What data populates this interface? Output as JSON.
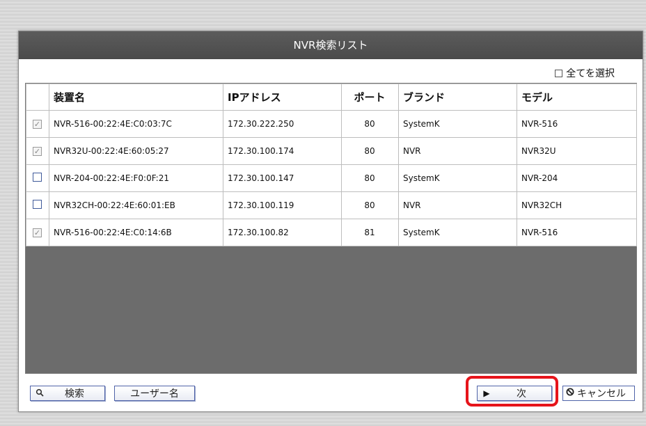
{
  "dialog": {
    "title": "NVR検索リスト",
    "select_all_label": "全てを選択"
  },
  "table": {
    "headers": [
      "装置名",
      "IPアドレス",
      "ポート",
      "ブランド",
      "モデル"
    ],
    "rows": [
      {
        "checked": true,
        "name": "NVR-516-00:22:4E:C0:03:7C",
        "ip": "172.30.222.250",
        "port": "80",
        "brand": "SystemK",
        "model": "NVR-516"
      },
      {
        "checked": true,
        "name": "NVR32U-00:22:4E:60:05:27",
        "ip": "172.30.100.174",
        "port": "80",
        "brand": "NVR",
        "model": "NVR32U"
      },
      {
        "checked": false,
        "name": "NVR-204-00:22:4E:F0:0F:21",
        "ip": "172.30.100.147",
        "port": "80",
        "brand": "SystemK",
        "model": "NVR-204"
      },
      {
        "checked": false,
        "name": "NVR32CH-00:22:4E:60:01:EB",
        "ip": "172.30.100.119",
        "port": "80",
        "brand": "NVR",
        "model": "NVR32CH"
      },
      {
        "checked": true,
        "name": "NVR-516-00:22:4E:C0:14:6B",
        "ip": "172.30.100.82",
        "port": "81",
        "brand": "SystemK",
        "model": "NVR-516"
      }
    ]
  },
  "footer": {
    "search_label": "検索",
    "user_label": "ユーザー名",
    "next_label": "次",
    "cancel_label": "キャンセル"
  },
  "icons": {
    "search": "magnifier-icon",
    "next": "play-icon",
    "cancel": "cancel-icon"
  },
  "colors": {
    "titlebar": "#4f4f4f",
    "list_background": "#6c6c6c",
    "button_border": "#4f63a8",
    "highlight": "#e6141b"
  }
}
